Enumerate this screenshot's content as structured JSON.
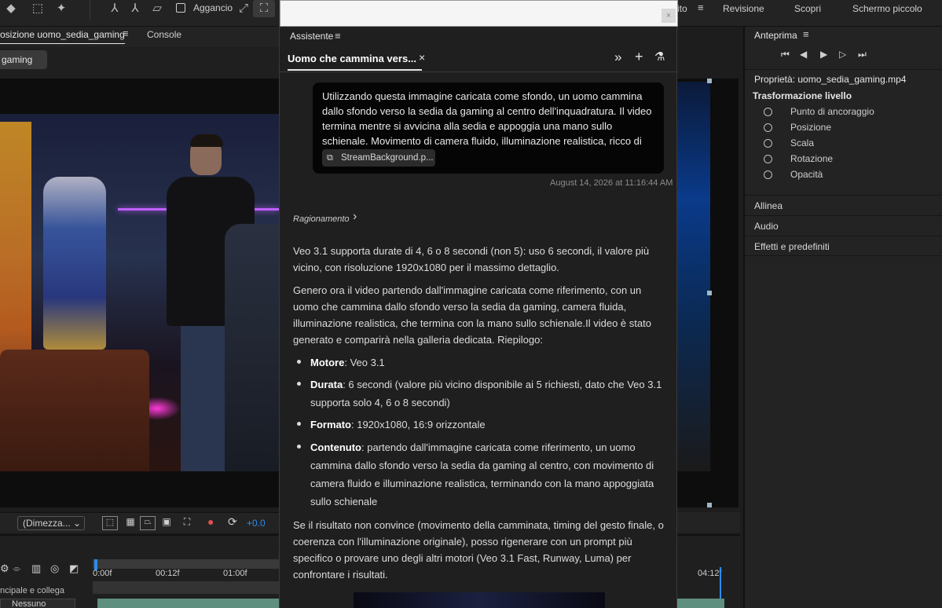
{
  "toolbar": {
    "snap_label": "Agganci",
    "snap_label_tail": "o"
  },
  "workspace": {
    "items": [
      "ito",
      "Revisione",
      "Scopri",
      "Schermo piccolo"
    ]
  },
  "composition": {
    "tab_label": "osizione uomo_sedia_gaming",
    "console_label": "Console",
    "sub_tab_label": "gaming",
    "resolution": "(Dimezza...",
    "exposure": "+0.0"
  },
  "timeline": {
    "ticks": [
      "0:00f",
      "00:12f",
      "01:00f",
      "04:12f"
    ],
    "parent_label": "ncipale e collega",
    "parent_value": "Nessuno"
  },
  "assistant": {
    "header_label": "Assistente",
    "tab_label": "Uomo che cammina vers...",
    "prompt": "Utilizzando questa immagine caricata come sfondo, un uomo cammina dallo sfondo verso la sedia da gaming al centro dell'inquadratura. Il video termina mentre si avvicina alla sedia e appoggia una mano sullo schienale. Movimento di camera fluido, illuminazione realistica, ricco di dettagli.",
    "attachment": "StreamBackground.p...",
    "timestamp": "August 14, 2026 at 11:16:44 AM",
    "reasoning_label": "Ragionamento",
    "para1": "Veo 3.1 supporta durate di 4, 6 o 8 secondi (non 5): uso 6 secondi, il valore più vicino, con risoluzione 1920x1080 per il massimo dettaglio.",
    "para2": "Genero ora il video partendo dall'immagine caricata come riferimento, con un uomo che cammina dallo sfondo verso la sedia da gaming, camera fluida, illuminazione realistica, che termina con la mano sullo schienale.Il video è stato generato e comparirà nella galleria dedicata. Riepilogo:",
    "bullets": [
      {
        "label": "Motore",
        "text": ": Veo 3.1"
      },
      {
        "label": "Durata",
        "text": ": 6 secondi (valore più vicino disponibile ai 5 richiesti, dato che Veo 3.1 supporta solo 4, 6 o 8 secondi)"
      },
      {
        "label": "Formato",
        "text": ": 1920x1080, 16:9 orizzontale"
      },
      {
        "label": "Contenuto",
        "text": ": partendo dall'immagine caricata come riferimento, un uomo cammina dallo sfondo verso la sedia da gaming al centro, con movimento di camera fluido e illuminazione realistica, terminando con la mano appoggiata sullo schienale"
      }
    ],
    "para3": "Se il risultato non convince (movimento della camminata, timing del gesto finale, o coerenza con l'illuminazione originale), posso rigenerare con un prompt più specifico o provare uno degli altri motori (Veo 3.1 Fast, Runway, Luma) per confrontare i risultati."
  },
  "properties": {
    "preview_label": "Anteprima",
    "title": "Proprietà: uomo_sedia_gaming.mp4",
    "transform_label": "Trasformazione livello",
    "transform_items": [
      "Punto di ancoraggio",
      "Posizione",
      "Scala",
      "Rotazione",
      "Opacità"
    ],
    "sections": [
      "Allinea",
      "Audio",
      "Effetti e predefiniti"
    ]
  },
  "colors": {
    "accent_blue": "#2d8ceb",
    "panel_bg": "#232323",
    "bubble_bg": "#050505"
  }
}
